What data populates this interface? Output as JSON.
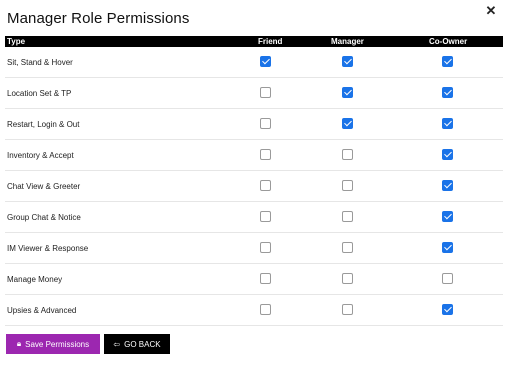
{
  "dialog": {
    "title": "Manager Role Permissions"
  },
  "table": {
    "headers": {
      "type": "Type",
      "friend": "Friend",
      "manager": "Manager",
      "coowner": "Co-Owner"
    },
    "rows": [
      {
        "label": "Sit, Stand & Hover",
        "friend": true,
        "manager": true,
        "coowner": true
      },
      {
        "label": "Location Set & TP",
        "friend": false,
        "manager": true,
        "coowner": true
      },
      {
        "label": "Restart, Login & Out",
        "friend": false,
        "manager": true,
        "coowner": true
      },
      {
        "label": "Inventory & Accept",
        "friend": false,
        "manager": false,
        "coowner": true
      },
      {
        "label": "Chat View & Greeter",
        "friend": false,
        "manager": false,
        "coowner": true
      },
      {
        "label": "Group Chat & Notice",
        "friend": false,
        "manager": false,
        "coowner": true
      },
      {
        "label": "IM Viewer & Response",
        "friend": false,
        "manager": false,
        "coowner": true
      },
      {
        "label": "Manage Money",
        "friend": false,
        "manager": false,
        "coowner": false
      },
      {
        "label": "Upsies & Advanced",
        "friend": false,
        "manager": false,
        "coowner": true
      }
    ]
  },
  "buttons": {
    "save_label": "Save Permissions",
    "save_icon": "lock-icon",
    "back_label": "GO BACK",
    "back_icon": "arrow-left-icon"
  },
  "colors": {
    "checked": "#1a73e8",
    "save_button": "#9c27b0",
    "back_button": "#000000",
    "header_bg": "#000000"
  }
}
